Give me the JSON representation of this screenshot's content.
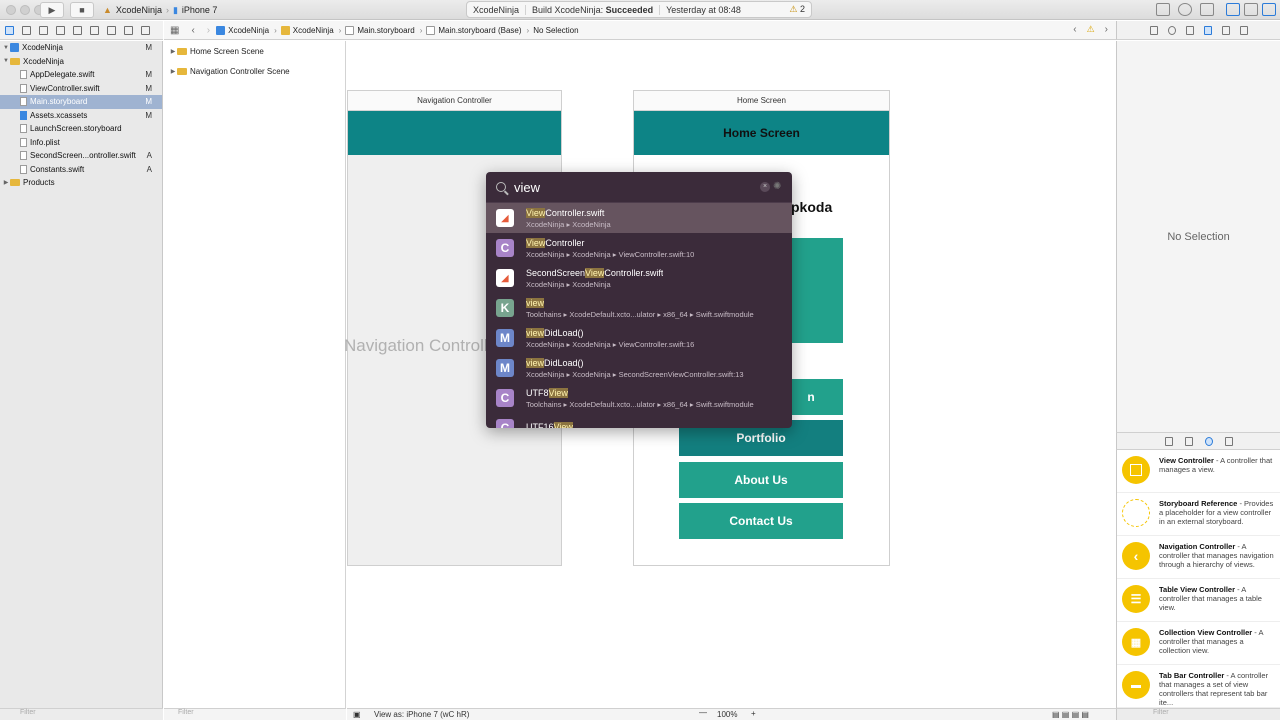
{
  "toolbar": {
    "scheme": "XcodeNinja",
    "device": "iPhone 7",
    "activity_project": "XcodeNinja",
    "activity_status_prefix": "Build XcodeNinja:",
    "activity_status": "Succeeded",
    "activity_time": "Yesterday at 08:48",
    "warning_count": "2"
  },
  "navigator": {
    "items": [
      {
        "label": "XcodeNinja",
        "badge": "M"
      },
      {
        "label": "XcodeNinja",
        "badge": ""
      },
      {
        "label": "AppDelegate.swift",
        "badge": "M"
      },
      {
        "label": "ViewController.swift",
        "badge": "M"
      },
      {
        "label": "Main.storyboard",
        "badge": "M"
      },
      {
        "label": "Assets.xcassets",
        "badge": "M"
      },
      {
        "label": "LaunchScreen.storyboard",
        "badge": ""
      },
      {
        "label": "Info.plist",
        "badge": ""
      },
      {
        "label": "SecondScreen...ontroller.swift",
        "badge": "A"
      },
      {
        "label": "Constants.swift",
        "badge": "A"
      },
      {
        "label": "Products",
        "badge": ""
      }
    ],
    "filter_placeholder": "Filter"
  },
  "jump_bar": {
    "crumbs": [
      "XcodeNinja",
      "XcodeNinja",
      "Main.storyboard",
      "Main.storyboard (Base)",
      "No Selection"
    ]
  },
  "outline": {
    "items": [
      "Home Screen Scene",
      "Navigation Controller Scene"
    ],
    "filter_placeholder": "Filter"
  },
  "canvas": {
    "nav_scene_title": "Navigation Controller",
    "nav_scene_label": "Navigation Controller",
    "home_scene_title": "Home Screen",
    "home_nav_title": "Home Screen",
    "partial_label": "pkoda",
    "partial_button": "n",
    "buttons": [
      "Portfolio",
      "About Us",
      "Contact Us"
    ],
    "view_as": "View as: iPhone 7 (wC hR)",
    "zoom": "100%"
  },
  "quick_open": {
    "query": "view",
    "results": [
      {
        "icon": "swift",
        "pre": "",
        "hl": "View",
        "post": "Controller.swift",
        "path": "XcodeNinja ▸ XcodeNinja"
      },
      {
        "icon": "C",
        "pre": "",
        "hl": "View",
        "post": "Controller",
        "path": "XcodeNinja ▸ XcodeNinja ▸ ViewController.swift:10"
      },
      {
        "icon": "swift",
        "pre": "SecondScreen",
        "hl": "View",
        "post": "Controller.swift",
        "path": "XcodeNinja ▸ XcodeNinja"
      },
      {
        "icon": "K",
        "pre": "",
        "hl": "view",
        "post": "",
        "path": "Toolchains ▸ XcodeDefault.xcto...ulator ▸ x86_64 ▸ Swift.swiftmodule"
      },
      {
        "icon": "M",
        "pre": "",
        "hl": "view",
        "post": "DidLoad()",
        "path": "XcodeNinja ▸ XcodeNinja ▸ ViewController.swift:16"
      },
      {
        "icon": "M",
        "pre": "",
        "hl": "view",
        "post": "DidLoad()",
        "path": "XcodeNinja ▸ XcodeNinja ▸ SecondScreenViewController.swift:13"
      },
      {
        "icon": "C",
        "pre": "UTF8",
        "hl": "View",
        "post": "",
        "path": "Toolchains ▸ XcodeDefault.xcto...ulator ▸ x86_64 ▸ Swift.swiftmodule"
      },
      {
        "icon": "C",
        "pre": "UTF16",
        "hl": "View",
        "post": "",
        "path": ""
      }
    ]
  },
  "inspector": {
    "empty_text": "No Selection"
  },
  "library": {
    "items": [
      {
        "title": "View Controller",
        "desc": " - A controller that manages a view."
      },
      {
        "title": "Storyboard Reference",
        "desc": " - Provides a placeholder for a view controller in an external storyboard."
      },
      {
        "title": "Navigation Controller",
        "desc": " - A controller that manages navigation through a hierarchy of views."
      },
      {
        "title": "Table View Controller",
        "desc": " - A controller that manages a table view."
      },
      {
        "title": "Collection View Controller",
        "desc": " - A controller that manages a collection view."
      },
      {
        "title": "Tab Bar Controller",
        "desc": " - A controller that manages a set of view controllers that represent tab bar ite..."
      }
    ],
    "filter_placeholder": "Filter"
  },
  "colors": {
    "teal_dark": "#0d8486",
    "teal_button": "#22a18c",
    "overlay_bg": "#3b2b3a",
    "library_yellow": "#f5c400"
  }
}
